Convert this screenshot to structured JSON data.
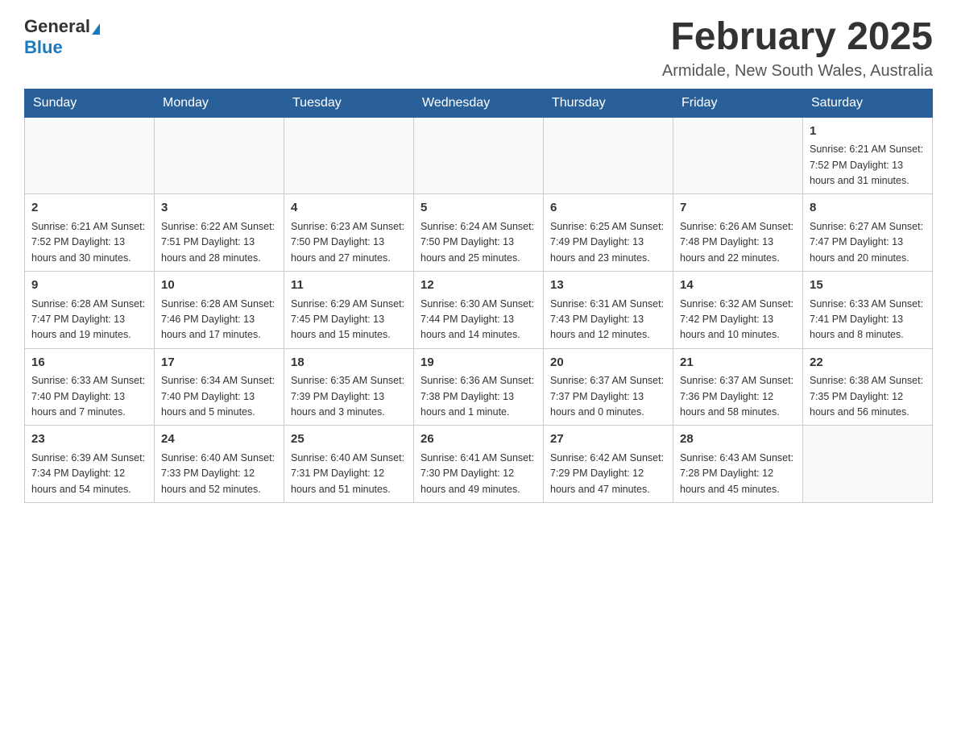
{
  "logo": {
    "general": "General",
    "blue": "Blue"
  },
  "title": "February 2025",
  "subtitle": "Armidale, New South Wales, Australia",
  "headers": [
    "Sunday",
    "Monday",
    "Tuesday",
    "Wednesday",
    "Thursday",
    "Friday",
    "Saturday"
  ],
  "weeks": [
    [
      {
        "day": "",
        "info": ""
      },
      {
        "day": "",
        "info": ""
      },
      {
        "day": "",
        "info": ""
      },
      {
        "day": "",
        "info": ""
      },
      {
        "day": "",
        "info": ""
      },
      {
        "day": "",
        "info": ""
      },
      {
        "day": "1",
        "info": "Sunrise: 6:21 AM\nSunset: 7:52 PM\nDaylight: 13 hours and 31 minutes."
      }
    ],
    [
      {
        "day": "2",
        "info": "Sunrise: 6:21 AM\nSunset: 7:52 PM\nDaylight: 13 hours and 30 minutes."
      },
      {
        "day": "3",
        "info": "Sunrise: 6:22 AM\nSunset: 7:51 PM\nDaylight: 13 hours and 28 minutes."
      },
      {
        "day": "4",
        "info": "Sunrise: 6:23 AM\nSunset: 7:50 PM\nDaylight: 13 hours and 27 minutes."
      },
      {
        "day": "5",
        "info": "Sunrise: 6:24 AM\nSunset: 7:50 PM\nDaylight: 13 hours and 25 minutes."
      },
      {
        "day": "6",
        "info": "Sunrise: 6:25 AM\nSunset: 7:49 PM\nDaylight: 13 hours and 23 minutes."
      },
      {
        "day": "7",
        "info": "Sunrise: 6:26 AM\nSunset: 7:48 PM\nDaylight: 13 hours and 22 minutes."
      },
      {
        "day": "8",
        "info": "Sunrise: 6:27 AM\nSunset: 7:47 PM\nDaylight: 13 hours and 20 minutes."
      }
    ],
    [
      {
        "day": "9",
        "info": "Sunrise: 6:28 AM\nSunset: 7:47 PM\nDaylight: 13 hours and 19 minutes."
      },
      {
        "day": "10",
        "info": "Sunrise: 6:28 AM\nSunset: 7:46 PM\nDaylight: 13 hours and 17 minutes."
      },
      {
        "day": "11",
        "info": "Sunrise: 6:29 AM\nSunset: 7:45 PM\nDaylight: 13 hours and 15 minutes."
      },
      {
        "day": "12",
        "info": "Sunrise: 6:30 AM\nSunset: 7:44 PM\nDaylight: 13 hours and 14 minutes."
      },
      {
        "day": "13",
        "info": "Sunrise: 6:31 AM\nSunset: 7:43 PM\nDaylight: 13 hours and 12 minutes."
      },
      {
        "day": "14",
        "info": "Sunrise: 6:32 AM\nSunset: 7:42 PM\nDaylight: 13 hours and 10 minutes."
      },
      {
        "day": "15",
        "info": "Sunrise: 6:33 AM\nSunset: 7:41 PM\nDaylight: 13 hours and 8 minutes."
      }
    ],
    [
      {
        "day": "16",
        "info": "Sunrise: 6:33 AM\nSunset: 7:40 PM\nDaylight: 13 hours and 7 minutes."
      },
      {
        "day": "17",
        "info": "Sunrise: 6:34 AM\nSunset: 7:40 PM\nDaylight: 13 hours and 5 minutes."
      },
      {
        "day": "18",
        "info": "Sunrise: 6:35 AM\nSunset: 7:39 PM\nDaylight: 13 hours and 3 minutes."
      },
      {
        "day": "19",
        "info": "Sunrise: 6:36 AM\nSunset: 7:38 PM\nDaylight: 13 hours and 1 minute."
      },
      {
        "day": "20",
        "info": "Sunrise: 6:37 AM\nSunset: 7:37 PM\nDaylight: 13 hours and 0 minutes."
      },
      {
        "day": "21",
        "info": "Sunrise: 6:37 AM\nSunset: 7:36 PM\nDaylight: 12 hours and 58 minutes."
      },
      {
        "day": "22",
        "info": "Sunrise: 6:38 AM\nSunset: 7:35 PM\nDaylight: 12 hours and 56 minutes."
      }
    ],
    [
      {
        "day": "23",
        "info": "Sunrise: 6:39 AM\nSunset: 7:34 PM\nDaylight: 12 hours and 54 minutes."
      },
      {
        "day": "24",
        "info": "Sunrise: 6:40 AM\nSunset: 7:33 PM\nDaylight: 12 hours and 52 minutes."
      },
      {
        "day": "25",
        "info": "Sunrise: 6:40 AM\nSunset: 7:31 PM\nDaylight: 12 hours and 51 minutes."
      },
      {
        "day": "26",
        "info": "Sunrise: 6:41 AM\nSunset: 7:30 PM\nDaylight: 12 hours and 49 minutes."
      },
      {
        "day": "27",
        "info": "Sunrise: 6:42 AM\nSunset: 7:29 PM\nDaylight: 12 hours and 47 minutes."
      },
      {
        "day": "28",
        "info": "Sunrise: 6:43 AM\nSunset: 7:28 PM\nDaylight: 12 hours and 45 minutes."
      },
      {
        "day": "",
        "info": ""
      }
    ]
  ]
}
